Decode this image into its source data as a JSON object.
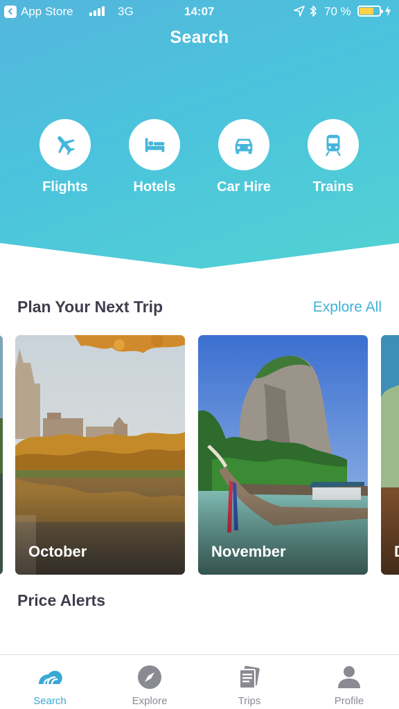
{
  "status_bar": {
    "back_label": "App Store",
    "network": "3G",
    "time": "14:07",
    "battery_percent": "70 %",
    "battery_level": 0.7
  },
  "header": {
    "title": "Search"
  },
  "categories": [
    {
      "label": "Flights",
      "icon": "airplane-icon"
    },
    {
      "label": "Hotels",
      "icon": "bed-icon"
    },
    {
      "label": "Car Hire",
      "icon": "car-icon"
    },
    {
      "label": "Trains",
      "icon": "train-icon"
    }
  ],
  "plan": {
    "title": "Plan Your Next Trip",
    "explore_all": "Explore All",
    "cards": [
      {
        "month": "October"
      },
      {
        "month": "November"
      }
    ],
    "partial_next_card_initial": "D"
  },
  "price_alerts": {
    "title": "Price Alerts"
  },
  "tab_bar": {
    "tabs": [
      {
        "label": "Search",
        "icon": "skyscanner-search-icon",
        "active": true
      },
      {
        "label": "Explore",
        "icon": "compass-icon",
        "active": false
      },
      {
        "label": "Trips",
        "icon": "tickets-icon",
        "active": false
      },
      {
        "label": "Profile",
        "icon": "person-icon",
        "active": false
      }
    ]
  },
  "colors": {
    "gradient_start": "#53b6dc",
    "gradient_end": "#52d2d2",
    "accent": "#38a9d6",
    "battery": "#ffd24a",
    "heading_text": "#3e3e4e",
    "inactive_tab": "#8a8a92"
  }
}
